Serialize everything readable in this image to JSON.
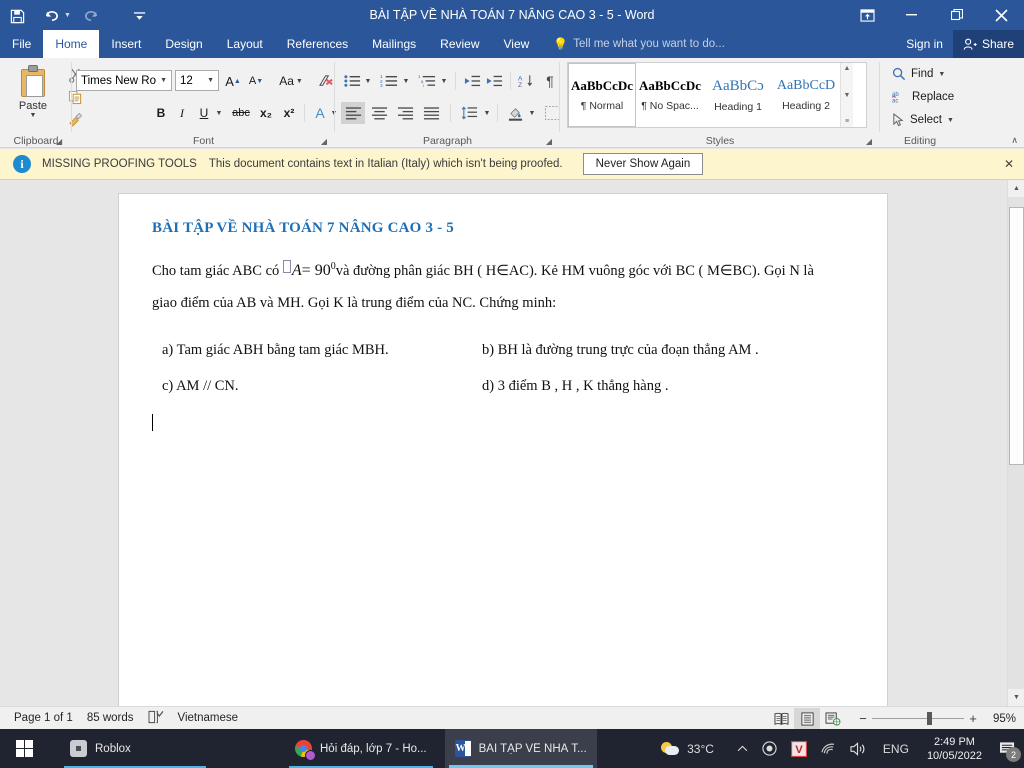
{
  "titlebar": {
    "document_title": "BÀI TẬP VỀ NHÀ TOÁN 7 NÂNG CAO 3 - 5 - Word",
    "qat": [
      {
        "name": "save",
        "glyph": "💾"
      },
      {
        "name": "undo",
        "glyph": "↶"
      },
      {
        "name": "redo",
        "glyph": "↻"
      },
      {
        "name": "customize-quick-access-toolbar",
        "glyph": "☷"
      }
    ],
    "window_buttons": {
      "ribbon_display_options": "⌧",
      "minimize": "—",
      "restore": "❐",
      "close": "✕"
    }
  },
  "tabs": [
    {
      "label": "File",
      "active": false
    },
    {
      "label": "Home",
      "active": true
    },
    {
      "label": "Insert",
      "active": false
    },
    {
      "label": "Design",
      "active": false
    },
    {
      "label": "Layout",
      "active": false
    },
    {
      "label": "References",
      "active": false
    },
    {
      "label": "Mailings",
      "active": false
    },
    {
      "label": "Review",
      "active": false
    },
    {
      "label": "View",
      "active": false
    }
  ],
  "tellme": {
    "placeholder": "Tell me what you want to do..."
  },
  "account": {
    "signin_label": "Sign in",
    "share_label": "Share"
  },
  "ribbon": {
    "groups": [
      {
        "label": "Clipboard"
      },
      {
        "label": "Font"
      },
      {
        "label": "Paragraph"
      },
      {
        "label": "Styles"
      },
      {
        "label": "Editing"
      }
    ],
    "clipboard": {
      "paste_label": "Paste",
      "cut_glyph": "✂",
      "copy_glyph": "❐",
      "format_painter_glyph": "🖌"
    },
    "font": {
      "font_name": "Times New Ro",
      "font_size": "12",
      "grow_font": "A",
      "shrink_font": "A",
      "change_case": "Aa",
      "clear_formatting": "✐",
      "bold": "B",
      "italic": "I",
      "underline": "U",
      "strikethrough": "abc",
      "subscript": "x₂",
      "superscript": "x²",
      "text_effects": "A",
      "highlight": "ab",
      "font_color": "A"
    },
    "paragraph": {
      "bullets": "☰",
      "numbering": "☰",
      "multilevel_list": "☰",
      "decrease_indent": "⇤",
      "increase_indent": "⇥",
      "sort": "A↓",
      "show_marks": "¶",
      "align_left": "≡",
      "align_center": "≡",
      "align_right": "≡",
      "justify": "≡",
      "line_spacing": "↕",
      "shading": "■",
      "borders": "⊞"
    },
    "styles": {
      "items": [
        {
          "preview": "AaBbCcDc",
          "name": "¶ Normal",
          "selected": true,
          "kind": "normal"
        },
        {
          "preview": "AaBbCcDc",
          "name": "¶ No Spac...",
          "selected": false,
          "kind": "normal"
        },
        {
          "preview": "AaBbCɔ",
          "name": "Heading 1",
          "selected": false,
          "kind": "h1"
        },
        {
          "preview": "AaBbCcD",
          "name": "Heading 2",
          "selected": false,
          "kind": "h2"
        }
      ],
      "scroll_up": "▲",
      "scroll_down": "▼",
      "more": "≡"
    },
    "editing": {
      "find_label": "Find",
      "replace_label": "Replace",
      "select_label": "Select"
    },
    "collapse_ribbon": "∧"
  },
  "message_bar": {
    "info_glyph": "i",
    "title": "MISSING PROOFING TOOLS",
    "text": "This document contains text in Italian (Italy) which isn't being proofed.",
    "button_label": "Never Show Again",
    "close_glyph": "✕"
  },
  "document": {
    "title": "BÀI TẬP VỀ NHÀ TOÁN 7 NÂNG CAO 3 - 5",
    "paragraph_line1_before_math": "Cho tam giác ABC có",
    "math": {
      "missing_glyph": "",
      "variable": "A",
      "relation": "= 90",
      "exponent": "0"
    },
    "paragraph_line1_after_math": "và đường phân giác BH ( H∈AC). Kẻ HM vuông góc với BC ( M∈BC). Gọi N là",
    "paragraph_line2": "giao điểm của AB và MH. Gọi K là trung điểm của NC. Chứng  minh:",
    "answers": [
      "a) Tam giác ABH bằng tam giác MBH.",
      "b) BH là đường trung trực của đoạn thẳng AM .",
      "c) AM // CN.",
      "d) 3 điểm B , H , K thẳng hàng ."
    ]
  },
  "scrollbar": {
    "up_glyph": "▲",
    "down_glyph": "▼"
  },
  "statusbar": {
    "page": "Page 1 of 1",
    "words": "85 words",
    "proofing_glyph": "📖",
    "language": "Vietnamese",
    "views": [
      {
        "name": "read-mode",
        "glyph": "📖",
        "active": false
      },
      {
        "name": "print-layout",
        "glyph": "▤",
        "active": true
      },
      {
        "name": "web-layout",
        "glyph": "▤",
        "active": false
      }
    ],
    "zoom_out": "−",
    "zoom_in": "+",
    "zoom_level": "95%"
  },
  "taskbar": {
    "start_label": "Start",
    "items": [
      {
        "name": "roblox",
        "label": "Roblox",
        "active": false
      },
      {
        "name": "chrome",
        "label": "Hỏi đáp, lớp 7 - Ho...",
        "active": false
      },
      {
        "name": "word",
        "label": "BÀI TẬP VỀ NHÀ T...",
        "active": true
      }
    ],
    "tray": {
      "temperature": "33°C",
      "chevron": "∧",
      "record_glyph": "◉",
      "vietkey_glyph": "V",
      "wifi_glyph": "◠",
      "volume_glyph": "🔊",
      "language": "ENG",
      "time": "2:49 PM",
      "date": "10/05/2022",
      "notification_count": "2"
    }
  },
  "colors": {
    "word_blue": "#2b579a",
    "share_blue": "#1f4178",
    "message_bar": "#fdf5cd",
    "heading_blue": "#1f6fb4",
    "taskbar": "#1f2430"
  }
}
